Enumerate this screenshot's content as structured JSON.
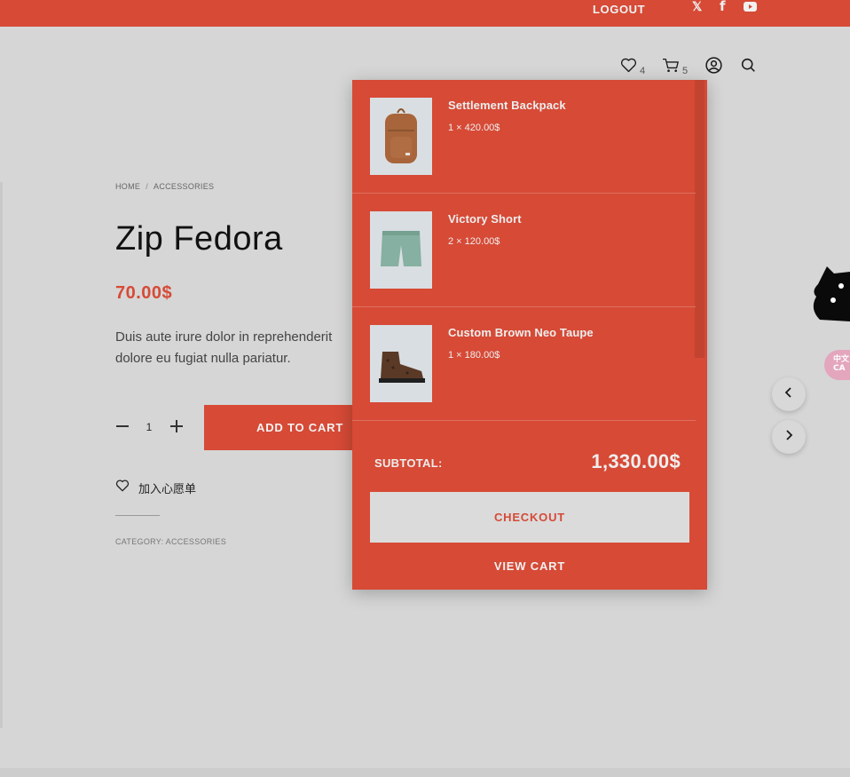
{
  "topbar": {
    "logout_label": "LOGOUT",
    "social": [
      {
        "icon": "x-twitter-icon",
        "glyph": "𝕏"
      },
      {
        "icon": "facebook-icon",
        "glyph": "f"
      },
      {
        "icon": "youtube-icon",
        "glyph": ""
      }
    ]
  },
  "header": {
    "wishlist_count": "4",
    "cart_count": "5",
    "icons": [
      "heart-icon",
      "cart-icon",
      "account-icon",
      "search-icon"
    ]
  },
  "breadcrumb": {
    "home": "HOME",
    "separator": "/",
    "current": "ACCESSORIES"
  },
  "product": {
    "title": "Zip Fedora",
    "price": "70.00$",
    "description_line1": "Duis aute irure dolor in reprehenderit",
    "description_line2": "dolore eu fugiat nulla pariatur.",
    "quantity": "1",
    "add_to_cart_label": "ADD TO CART",
    "wishlist_label": "加入心愿单",
    "category_text": "CATEGORY: ACCESSORIES"
  },
  "mini_cart": {
    "items": [
      {
        "name": "Settlement Backpack",
        "qty_price": "1 × 420.00$",
        "image": "backpack"
      },
      {
        "name": "Victory Short",
        "qty_price": "2 × 120.00$",
        "image": "shorts"
      },
      {
        "name": "Custom Brown Neo Taupe",
        "qty_price": "1 × 180.00$",
        "image": "sneaker"
      }
    ],
    "subtotal_label": "SUBTOTAL:",
    "subtotal_value": "1,330.00$",
    "checkout_label": "CHECKOUT",
    "view_cart_label": "VIEW CART"
  },
  "floating": {
    "translate_badge": "中文\nCA",
    "arrows": [
      "chevron-left-icon",
      "chevron-right-icon"
    ]
  },
  "colors": {
    "accent": "#d64a36",
    "background": "#d6d6d6",
    "text": "#1a1a1a"
  }
}
